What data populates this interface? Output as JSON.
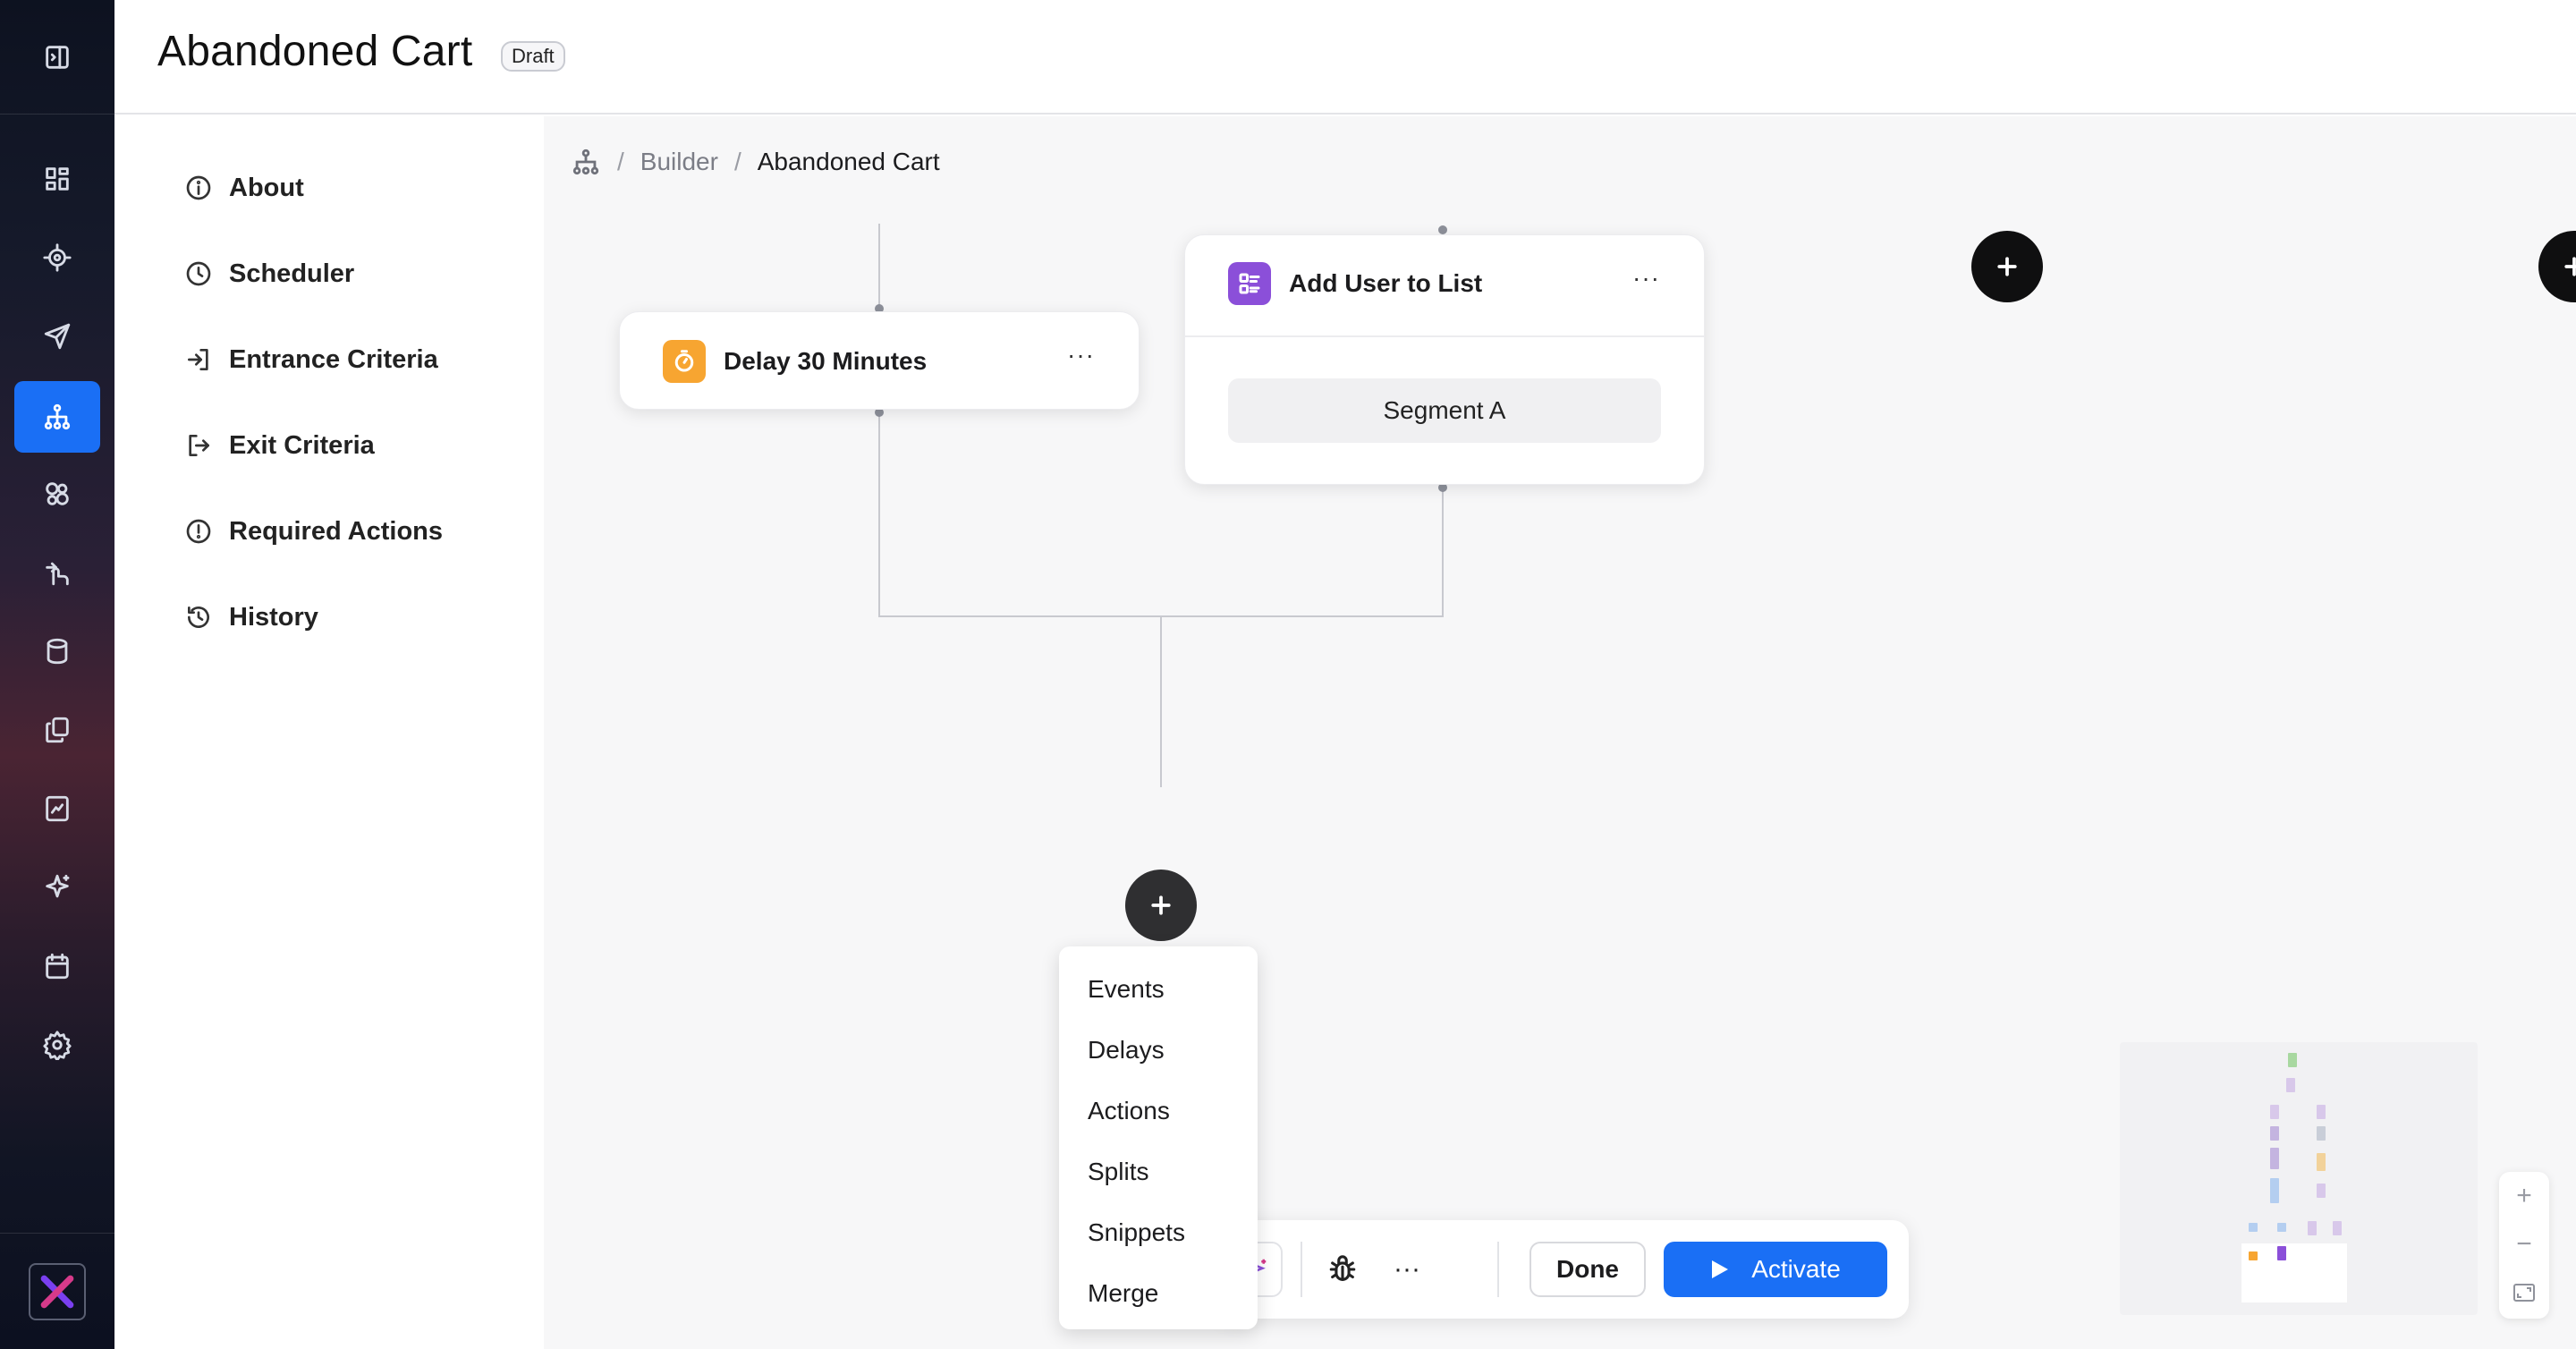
{
  "header": {
    "title": "Abandoned Cart",
    "status_badge": "Draft"
  },
  "rail": {
    "icons": [
      "sidebar-toggle-icon",
      "dashboard-icon",
      "target-icon",
      "send-icon",
      "journey-icon",
      "segments-icon",
      "interactions-icon",
      "database-icon",
      "copy-icon",
      "report-icon",
      "sparkle-icon",
      "calendar-icon",
      "gear-icon",
      "brand-logo"
    ],
    "active": "journey-icon"
  },
  "settings_nav": {
    "items": [
      {
        "label": "About",
        "icon": "info-icon"
      },
      {
        "label": "Scheduler",
        "icon": "clock-icon"
      },
      {
        "label": "Entrance Criteria",
        "icon": "enter-icon"
      },
      {
        "label": "Exit Criteria",
        "icon": "exit-icon"
      },
      {
        "label": "Required Actions",
        "icon": "alert-icon"
      },
      {
        "label": "History",
        "icon": "history-icon"
      }
    ]
  },
  "breadcrumb": {
    "root_icon": "journey-icon",
    "items": [
      "Builder",
      "Abandoned Cart"
    ]
  },
  "canvas": {
    "nodes": {
      "delay": {
        "title": "Delay 30 Minutes",
        "icon": "timer-icon",
        "icon_color": "#f7a531",
        "more": "···"
      },
      "add_list": {
        "title": "Add User to List",
        "icon": "list-icon",
        "icon_color": "#8b4fd9",
        "more": "···",
        "segment": "Segment A"
      }
    }
  },
  "add_menu": {
    "items": [
      "Events",
      "Delays",
      "Actions",
      "Splits",
      "Snippets",
      "Merge"
    ]
  },
  "toolbar": {
    "more": "···",
    "done_label": "Done",
    "activate_label": "Activate"
  },
  "zoom": {
    "in": "+",
    "out": "−"
  },
  "colors": {
    "accent": "#1a6ff5",
    "delay_icon": "#f7a531",
    "list_icon": "#8b4fd9"
  }
}
